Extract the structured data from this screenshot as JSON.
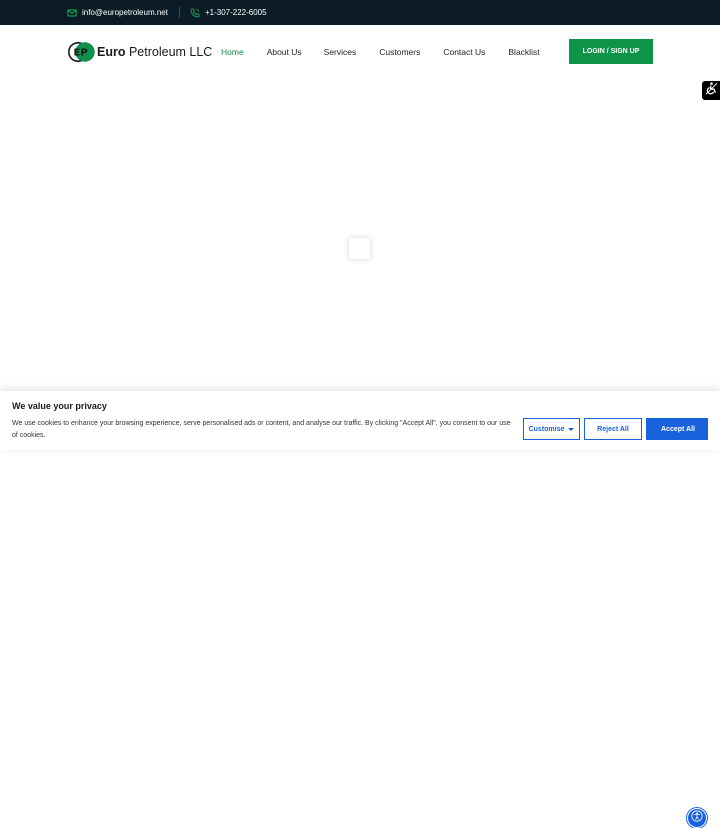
{
  "topbar": {
    "email": "info@europetroleum.net",
    "phone": "+1-307-222-6005",
    "icons": [
      "mail-icon",
      "phone-icon"
    ]
  },
  "brand": {
    "mark": "EP",
    "name_bold": "Euro",
    "name_rest": " Petroleum LLC"
  },
  "nav": {
    "items": [
      {
        "label": "Home",
        "active": true
      },
      {
        "label": "About Us",
        "active": false
      },
      {
        "label": "Services",
        "active": false
      },
      {
        "label": "Customers",
        "active": false
      },
      {
        "label": "Contact Us",
        "active": false
      },
      {
        "label": "Blacklist",
        "active": false
      }
    ],
    "login_label": "LOGIN / SIGN UP"
  },
  "cookie_banner": {
    "title": "We value your privacy",
    "text": "We use cookies to enhance your browsing experience, serve personalised ads or content, and analyse our traffic. By clicking \"Accept All\", you consent to our use of cookies.",
    "customise_label": "Customise",
    "reject_label": "Reject All",
    "accept_label": "Accept All"
  },
  "colors": {
    "topbar_bg": "#0b1c26",
    "brand_green": "#0f8f4c",
    "button_green": "#0d9447",
    "cookie_blue": "#1863dc"
  }
}
